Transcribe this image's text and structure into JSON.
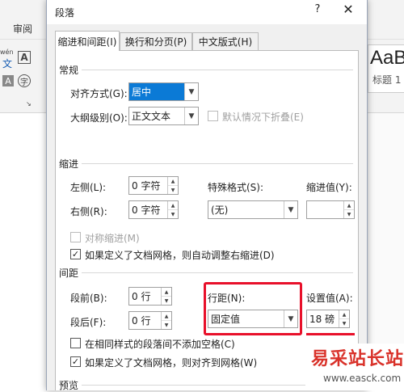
{
  "ribbon": {
    "tab_review": "审阅",
    "icon_wen": "wén",
    "icon_wen_char": "文",
    "icon_boxed_a": "A",
    "icon_shaded_a": "A",
    "icon_circle": "字",
    "style_preview": "AaB",
    "style_name": "标题 1"
  },
  "dialog": {
    "title": "段落",
    "help": "?",
    "close": "✕",
    "tabs": [
      "缩进和间距(I)",
      "换行和分页(P)",
      "中文版式(H)"
    ],
    "general": {
      "section": "常规",
      "alignment_label": "对齐方式(G):",
      "alignment_value": "居中",
      "outline_label": "大纲级别(O):",
      "outline_value": "正文文本",
      "collapse_label": "默认情况下折叠(E)"
    },
    "indent": {
      "section": "缩进",
      "left_label": "左侧(L):",
      "left_value": "0 字符",
      "right_label": "右侧(R):",
      "right_value": "0 字符",
      "special_label": "特殊格式(S):",
      "special_value": "(无)",
      "by_label": "缩进值(Y):",
      "by_value": "",
      "mirror_label": "对称缩进(M)",
      "auto_adjust_label": "如果定义了文档网格，则自动调整右缩进(D)"
    },
    "spacing": {
      "section": "间距",
      "before_label": "段前(B):",
      "before_value": "0 行",
      "after_label": "段后(F):",
      "after_value": "0 行",
      "line_label": "行距(N):",
      "line_value": "固定值",
      "at_label": "设置值(A):",
      "at_value": "18 磅",
      "no_space_label": "在相同样式的段落间不添加空格(C)",
      "snap_grid_label": "如果定义了文档网格，则对齐到网格(W)"
    },
    "preview": {
      "section": "预览"
    }
  },
  "watermark": {
    "text": "易采站长站",
    "url": "www.easck.com"
  },
  "colors": {
    "accent": "#0b7ad6",
    "highlight_red": "#e8102a"
  }
}
